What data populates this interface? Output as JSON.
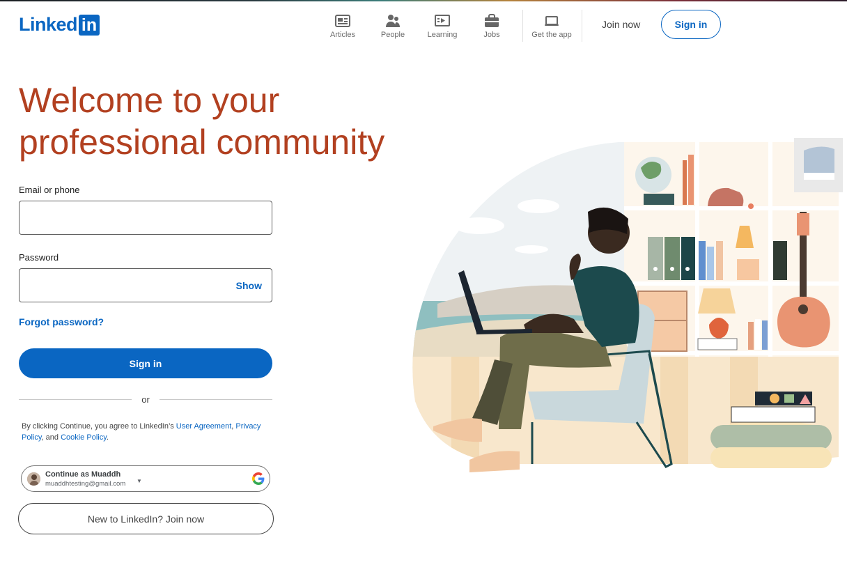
{
  "header": {
    "logo_text": "Linked",
    "logo_in": "in",
    "nav": [
      {
        "label": "Articles",
        "icon": "articles-icon"
      },
      {
        "label": "People",
        "icon": "people-icon"
      },
      {
        "label": "Learning",
        "icon": "learning-icon"
      },
      {
        "label": "Jobs",
        "icon": "jobs-icon"
      },
      {
        "label": "Get the app",
        "icon": "laptop-icon"
      }
    ],
    "join_now": "Join now",
    "sign_in": "Sign in"
  },
  "hero": {
    "line1": "Welcome to your",
    "line2": "professional community"
  },
  "form": {
    "email_label": "Email or phone",
    "email_value": "",
    "password_label": "Password",
    "password_value": "",
    "show_label": "Show",
    "forgot_label": "Forgot password?",
    "signin_label": "Sign in",
    "or_label": "or"
  },
  "terms": {
    "prefix": "By clicking Continue, you agree to LinkedIn’s ",
    "user_agreement": "User Agreement",
    "comma": ", ",
    "privacy": "Privacy Policy",
    "and": ", and ",
    "cookie": "Cookie Policy",
    "period": "."
  },
  "google": {
    "name": "Continue as Muaddh",
    "email": "muaddhtesting@gmail.com"
  },
  "join_button": "New to LinkedIn? Join now",
  "colors": {
    "brand": "#0a66c2",
    "headline": "#b24020"
  }
}
